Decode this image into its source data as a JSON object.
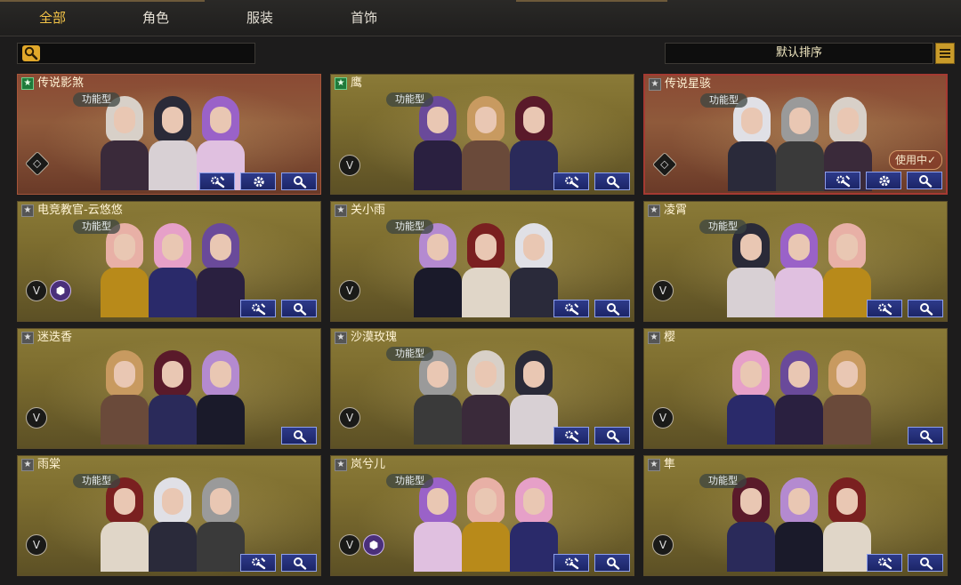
{
  "tabs": [
    {
      "label": "全部",
      "active": true
    },
    {
      "label": "角色",
      "active": false
    },
    {
      "label": "服装",
      "active": false
    },
    {
      "label": "首饰",
      "active": false
    }
  ],
  "search": {
    "placeholder": "",
    "value": ""
  },
  "sort": {
    "label": "默认排序"
  },
  "colors": {
    "accent": "#f3c347",
    "button": "#1c2567",
    "selected_border": "#a53a32"
  },
  "cards": [
    {
      "title": "传说影煞",
      "star": "green",
      "badge": "功能型",
      "buttons": [
        "wrench-gear",
        "gear",
        "search"
      ],
      "tag": "diamond",
      "theme": "red",
      "selected": false,
      "in_use": ""
    },
    {
      "title": "鹰",
      "star": "green",
      "badge": "功能型",
      "buttons": [
        "wrench-gear",
        "search"
      ],
      "tag": "v",
      "theme": "gold",
      "selected": false,
      "in_use": ""
    },
    {
      "title": "传说星骇",
      "star": "gray",
      "badge": "功能型",
      "buttons": [
        "wrench-gear",
        "gear",
        "search"
      ],
      "tag": "diamond",
      "theme": "red",
      "selected": true,
      "in_use": "使用中✓"
    },
    {
      "title": "电竞教官-云悠悠",
      "star": "gray",
      "badge": "功能型",
      "buttons": [
        "wrench-gear",
        "search"
      ],
      "tag": "v-hex",
      "theme": "gold",
      "selected": false,
      "in_use": ""
    },
    {
      "title": "关小雨",
      "star": "gray",
      "badge": "功能型",
      "buttons": [
        "wrench-gear",
        "search"
      ],
      "tag": "v",
      "theme": "gold",
      "selected": false,
      "in_use": ""
    },
    {
      "title": "凌霄",
      "star": "gray",
      "badge": "功能型",
      "buttons": [
        "wrench-gear",
        "search"
      ],
      "tag": "v",
      "theme": "gold",
      "selected": false,
      "in_use": ""
    },
    {
      "title": "迷迭香",
      "star": "gray",
      "badge": "",
      "buttons": [
        "search"
      ],
      "tag": "v",
      "theme": "gold",
      "selected": false,
      "in_use": ""
    },
    {
      "title": "沙漠玫瑰",
      "star": "gray",
      "badge": "功能型",
      "buttons": [
        "wrench-gear",
        "search"
      ],
      "tag": "v",
      "theme": "gold",
      "selected": false,
      "in_use": ""
    },
    {
      "title": "樱",
      "star": "gray",
      "badge": "",
      "buttons": [
        "search"
      ],
      "tag": "v",
      "theme": "gold",
      "selected": false,
      "in_use": ""
    },
    {
      "title": "雨棠",
      "star": "gray",
      "badge": "功能型",
      "buttons": [
        "wrench-gear",
        "search"
      ],
      "tag": "v",
      "theme": "gold",
      "selected": false,
      "in_use": ""
    },
    {
      "title": "岚兮儿",
      "star": "gray",
      "badge": "功能型",
      "buttons": [
        "wrench-gear",
        "search"
      ],
      "tag": "v-hex",
      "theme": "gold",
      "selected": false,
      "in_use": ""
    },
    {
      "title": "隼",
      "star": "gray",
      "badge": "功能型",
      "buttons": [
        "wrench-gear",
        "search"
      ],
      "tag": "v",
      "theme": "gold",
      "selected": false,
      "in_use": ""
    }
  ]
}
